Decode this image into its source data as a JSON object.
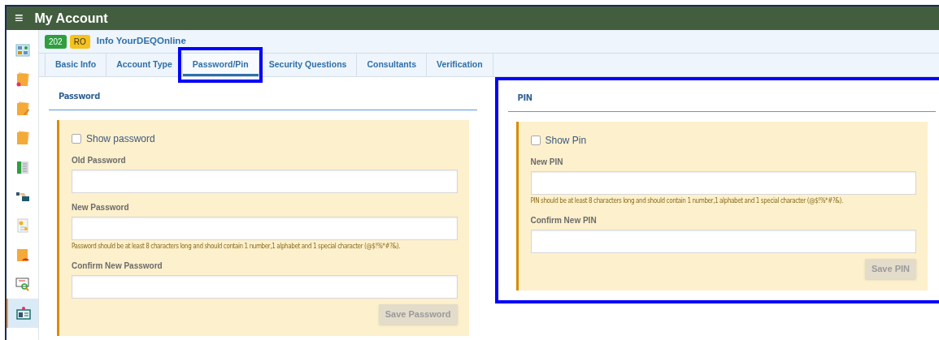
{
  "title_bar": {
    "menu_glyph": "≡",
    "title": "My Account"
  },
  "sidebar": {
    "items": [
      {
        "selected": false
      },
      {
        "selected": false
      },
      {
        "selected": false
      },
      {
        "selected": false
      },
      {
        "selected": false
      },
      {
        "selected": false
      },
      {
        "selected": false
      },
      {
        "selected": false
      },
      {
        "selected": false
      },
      {
        "selected": true
      }
    ]
  },
  "header": {
    "badges": [
      {
        "text": "202",
        "color": "#2e9e3e"
      },
      {
        "text": "RO",
        "color": "#f7c21b"
      }
    ],
    "title": "Info YourDEQOnline"
  },
  "tabs": [
    {
      "label": "Basic Info",
      "selected": false,
      "highlighted": false
    },
    {
      "label": "Account Type",
      "selected": false,
      "highlighted": false
    },
    {
      "label": "Password/Pin",
      "selected": true,
      "highlighted": true
    },
    {
      "label": "Security Questions",
      "selected": false,
      "highlighted": false
    },
    {
      "label": "Consultants",
      "selected": false,
      "highlighted": false
    },
    {
      "label": "Verification",
      "selected": false,
      "highlighted": false
    }
  ],
  "sections": [
    {
      "title": "Password",
      "highlighted": false,
      "checkbox": {
        "label": "Show password",
        "checked": false
      },
      "fields": [
        {
          "label": "Old Password"
        },
        {
          "label": "New Password",
          "hint": "Password should be at least 8 characters long and should contain 1 number,1 alphabet and 1 special character (@$!%*#?&)."
        },
        {
          "label": "Confirm New Password"
        }
      ],
      "button": {
        "label": "Save Password",
        "disabled": true
      }
    },
    {
      "title": "PIN",
      "highlighted": true,
      "checkbox": {
        "label": "Show Pin",
        "checked": false
      },
      "fields": [
        {
          "label": "New PIN",
          "hint": "PIN should be at least 8 characters long and should contain 1 number,1 alphabet and 1 special character (@$!%*#?&)."
        },
        {
          "label": "Confirm New PIN"
        }
      ],
      "button": {
        "label": "Save PIN",
        "disabled": true
      }
    }
  ]
}
